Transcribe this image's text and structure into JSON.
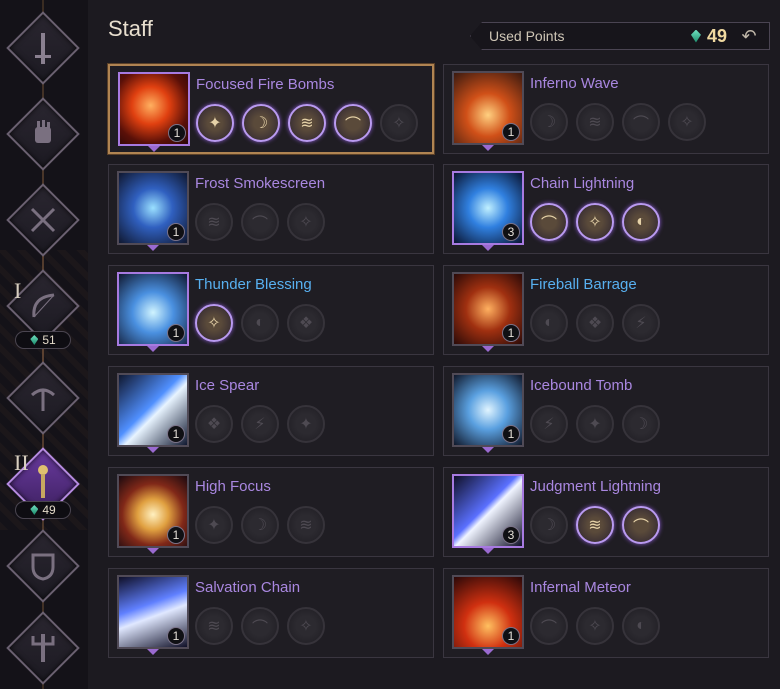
{
  "header": {
    "title": "Staff"
  },
  "used_points": {
    "label": "Used Points",
    "value": "49",
    "icon": "gem-icon"
  },
  "rail": {
    "roman": [
      "I",
      "II"
    ],
    "counts": [
      "51",
      "49"
    ],
    "icons": [
      "greatsword-icon",
      "gauntlet-icon",
      "dual-blades-icon",
      "bow-icon",
      "crossbow-icon",
      "staff-icon",
      "shield-icon",
      "trident-icon"
    ]
  },
  "skills": [
    {
      "name": "Focused Fire Bombs",
      "level": "1",
      "icon": "fire-orb-icon",
      "name_color": "#a987e0",
      "selected": true,
      "tripods": [
        true,
        true,
        true,
        true,
        false
      ]
    },
    {
      "name": "Inferno Wave",
      "level": "1",
      "icon": "inferno-icon",
      "name_color": "#a987e0",
      "tripods": [
        false,
        false,
        false,
        false
      ]
    },
    {
      "name": "Frost Smokescreen",
      "level": "1",
      "icon": "frost-swirl-icon",
      "name_color": "#a987e0",
      "tripods": [
        false,
        false,
        false
      ]
    },
    {
      "name": "Chain Lightning",
      "level": "3",
      "icon": "lightning-icon",
      "name_color": "#a987e0",
      "tripods": [
        true,
        true,
        true
      ]
    },
    {
      "name": "Thunder Blessing",
      "level": "1",
      "icon": "thunder-crystal-icon",
      "name_color": "#58b0f0",
      "tripods": [
        true,
        false,
        false
      ]
    },
    {
      "name": "Fireball Barrage",
      "level": "1",
      "icon": "fire-golem-icon",
      "name_color": "#58b0f0",
      "tripods": [
        false,
        false,
        false
      ]
    },
    {
      "name": "Ice Spear",
      "level": "1",
      "icon": "ice-spear-icon",
      "name_color": "#a987e0",
      "tripods": [
        false,
        false,
        false
      ]
    },
    {
      "name": "Icebound Tomb",
      "level": "1",
      "icon": "ice-tomb-icon",
      "name_color": "#a987e0",
      "tripods": [
        false,
        false,
        false
      ]
    },
    {
      "name": "High Focus",
      "level": "1",
      "icon": "focus-burst-icon",
      "name_color": "#a987e0",
      "tripods": [
        false,
        false,
        false
      ]
    },
    {
      "name": "Judgment Lightning",
      "level": "3",
      "icon": "judgment-bolt-icon",
      "name_color": "#a987e0",
      "tripods": [
        false,
        true,
        true
      ]
    },
    {
      "name": "Salvation Chain",
      "level": "1",
      "icon": "chain-icon",
      "name_color": "#a987e0",
      "tripods": [
        false,
        false,
        false
      ]
    },
    {
      "name": "Infernal Meteor",
      "level": "1",
      "icon": "meteor-icon",
      "name_color": "#a987e0",
      "tripods": [
        false,
        false,
        false
      ]
    }
  ]
}
